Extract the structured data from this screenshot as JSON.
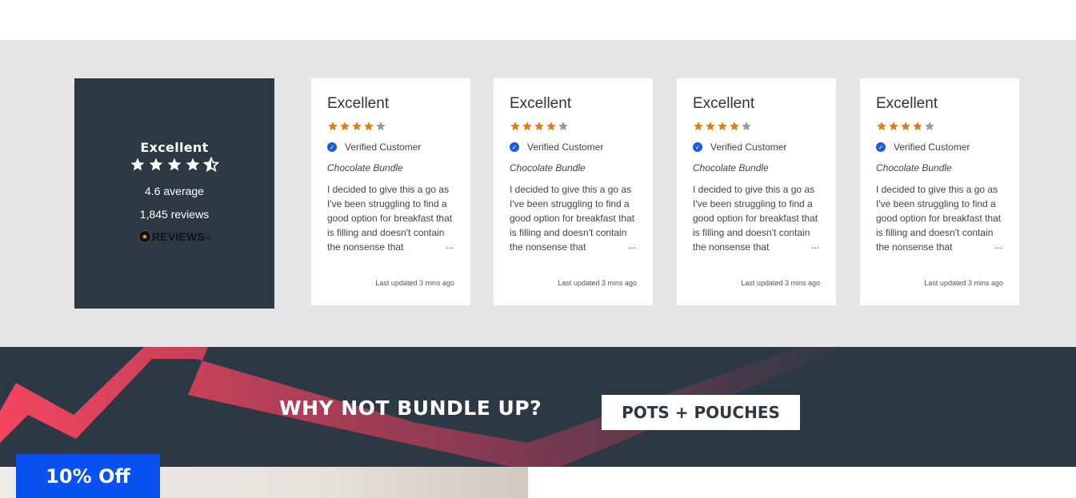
{
  "summary": {
    "rating_word": "Excellent",
    "stars": 4.5,
    "average": "4.6 average",
    "count": "1,845 reviews",
    "brand": {
      "name": "REVIEWS",
      "suffix": "io"
    }
  },
  "reviews": [
    {
      "title": "Excellent",
      "stars": 4,
      "verified": "Verified Customer",
      "product": "Chocolate Bundle",
      "body": "I decided to give this a go as I've been struggling to find a good option for breakfast that is filling and doesn't contain the nonsense that",
      "more": "...",
      "updated": "Last updated 3 mins ago"
    },
    {
      "title": "Excellent",
      "stars": 4,
      "verified": "Verified Customer",
      "product": "Chocolate Bundle",
      "body": "I decided to give this a go as I've been struggling to find a good option for breakfast that is filling and doesn't contain the nonsense that",
      "more": "...",
      "updated": "Last updated 3 mins ago"
    },
    {
      "title": "Excellent",
      "stars": 4,
      "verified": "Verified Customer",
      "product": "Chocolate Bundle",
      "body": "I decided to give this a go as I've been struggling to find a good option for breakfast that is filling and doesn't contain the nonsense that",
      "more": "...",
      "updated": "Last updated 3 mins ago"
    },
    {
      "title": "Excellent",
      "stars": 4,
      "verified": "Verified Customer",
      "product": "Chocolate Bundle",
      "body": "I decided to give this a go as I've been struggling to find a good option for breakfast that is filling and doesn't contain the nonsense that",
      "more": "...",
      "updated": "Last updated 3 mins ago"
    }
  ],
  "bundle": {
    "title": "WHY NOT BUNDLE UP?",
    "tag": "POTS + POUCHES"
  },
  "offer": {
    "label": "10% Off"
  },
  "colors": {
    "dark": "#2c3945",
    "band": "#e5e5e5",
    "star_filled": "#e07d1a",
    "star_empty": "#9a9a9a",
    "verified": "#1d5bd8",
    "accent_red": "#f2455e",
    "offer_blue": "#0a52f0"
  },
  "icons": {
    "star": "star-icon",
    "half_star": "half-star-icon",
    "verified": "check-circle-icon",
    "brand": "reviews-io-logo-icon"
  }
}
